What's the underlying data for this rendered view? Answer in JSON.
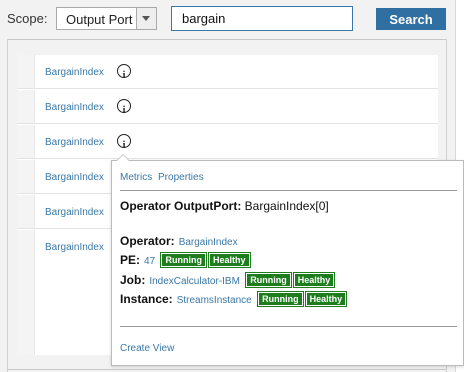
{
  "scope": {
    "label": "Scope:",
    "selected": "Output Port"
  },
  "search": {
    "value": "bargain",
    "button": "Search"
  },
  "results": [
    {
      "name": "BargainIndex"
    },
    {
      "name": "BargainIndex"
    },
    {
      "name": "BargainIndex"
    },
    {
      "name": "BargainIndex"
    },
    {
      "name": "BargainIndex"
    },
    {
      "name": "BargainIndex"
    }
  ],
  "popup": {
    "tabs": [
      "Metrics",
      "Properties"
    ],
    "title_label": "Operator OutputPort:",
    "title_value": "BargainIndex[0]",
    "operator": {
      "label": "Operator:",
      "value": "BargainIndex"
    },
    "pe": {
      "label": "PE:",
      "value": "47",
      "badges": [
        "Running",
        "Healthy"
      ]
    },
    "job": {
      "label": "Job:",
      "value": "IndexCalculator-IBM",
      "badges": [
        "Running",
        "Healthy"
      ]
    },
    "instance": {
      "label": "Instance:",
      "value": "StreamsInstance",
      "badges": [
        "Running",
        "Healthy"
      ]
    },
    "create_view": "Create View"
  },
  "colors": {
    "accent": "#3a78a8",
    "button": "#2f6fa2",
    "status_green": "#1e7e1e"
  }
}
